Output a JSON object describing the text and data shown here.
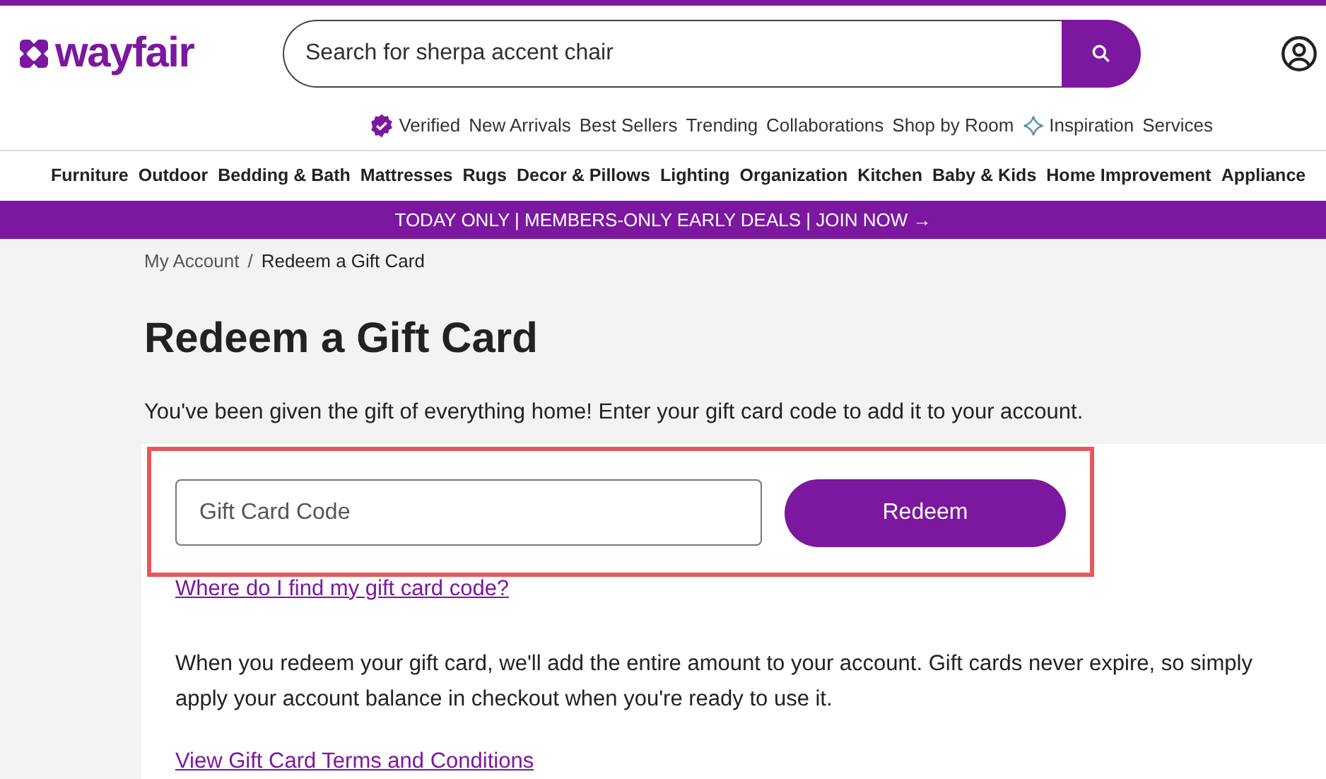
{
  "header": {
    "logo": "wayfair",
    "search": {
      "placeholder": "Search for sherpa accent chair"
    }
  },
  "top_links": [
    {
      "label": "Verified",
      "kind": "verified"
    },
    {
      "label": "New Arrivals",
      "kind": "plain"
    },
    {
      "label": "Best Sellers",
      "kind": "plain"
    },
    {
      "label": "Trending",
      "kind": "plain"
    },
    {
      "label": "Collaborations",
      "kind": "plain"
    },
    {
      "label": "Shop by Room",
      "kind": "plain"
    },
    {
      "label": "Inspiration",
      "kind": "sparkle"
    },
    {
      "label": "Services",
      "kind": "plain"
    }
  ],
  "categories": [
    "Furniture",
    "Outdoor",
    "Bedding & Bath",
    "Mattresses",
    "Rugs",
    "Decor & Pillows",
    "Lighting",
    "Organization",
    "Kitchen",
    "Baby & Kids",
    "Home Improvement",
    "Appliance"
  ],
  "promo": "TODAY ONLY | MEMBERS-ONLY EARLY DEALS | JOIN NOW →",
  "breadcrumb": {
    "items": [
      "My Account",
      "Redeem a Gift Card"
    ],
    "separator": "/"
  },
  "title": "Redeem a Gift Card",
  "intro": "You've been given the gift of everything home! Enter your gift card code to add it to your account.",
  "form": {
    "placeholder": "Gift Card Code",
    "button": "Redeem"
  },
  "help_link": "Where do I find my gift card code?",
  "info": "When you redeem your gift card, we'll add the entire amount to your account. Gift cards never expire, so simply apply your account balance in checkout when you're ready to use it.",
  "terms_link": "View Gift Card Terms and Conditions"
}
